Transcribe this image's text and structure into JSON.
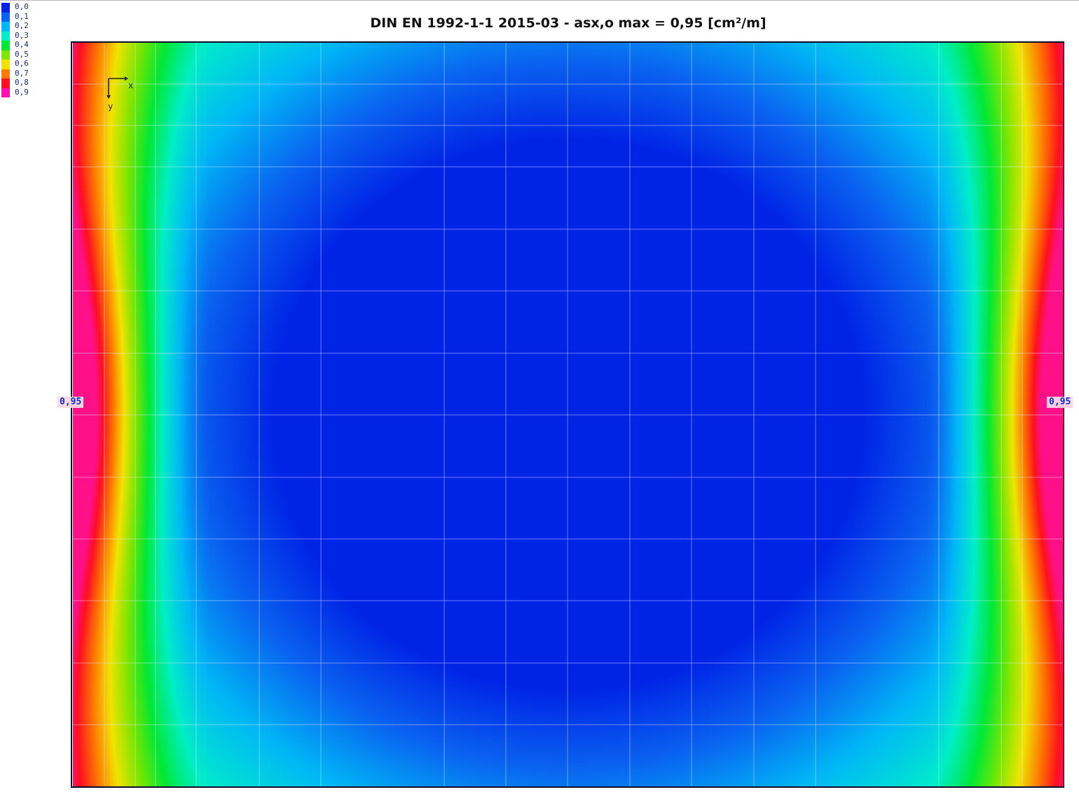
{
  "title": "DIN EN 1992-1-1 2015-03 - asx,o max = 0,95 [cm²/m]",
  "legend": {
    "entries": [
      {
        "label": "0,0",
        "color": "#0024e6"
      },
      {
        "label": "0,1",
        "color": "#0a62f0"
      },
      {
        "label": "0,2",
        "color": "#00b8f6"
      },
      {
        "label": "0,3",
        "color": "#00eec8"
      },
      {
        "label": "0,4",
        "color": "#00e836"
      },
      {
        "label": "0,5",
        "color": "#7ee600"
      },
      {
        "label": "0,6",
        "color": "#f0e400"
      },
      {
        "label": "0,7",
        "color": "#ff7a00"
      },
      {
        "label": "0,8",
        "color": "#ff1020"
      },
      {
        "label": "0,9",
        "color": "#ff10b0"
      }
    ]
  },
  "axis_indicator": {
    "x_label": "x",
    "y_label": "y"
  },
  "edge_labels": {
    "left": "0,95",
    "right": "0,95"
  },
  "chart_data": {
    "type": "heatmap",
    "title": "DIN EN 1992-1-1 2015-03 - asx,o max = 0,95 [cm²/m]",
    "max_value": 0.95,
    "scale_min": 0.0,
    "scale_max": 0.95,
    "max_locations": [
      "left edge mid-height",
      "right edge mid-height"
    ],
    "min_region": "center of slab",
    "colorscale": [
      "#0024e6",
      "#0a62f0",
      "#00b8f6",
      "#00eec8",
      "#00e836",
      "#7ee600",
      "#f0e400",
      "#ff7a00",
      "#ff1020",
      "#ff10b0"
    ]
  }
}
